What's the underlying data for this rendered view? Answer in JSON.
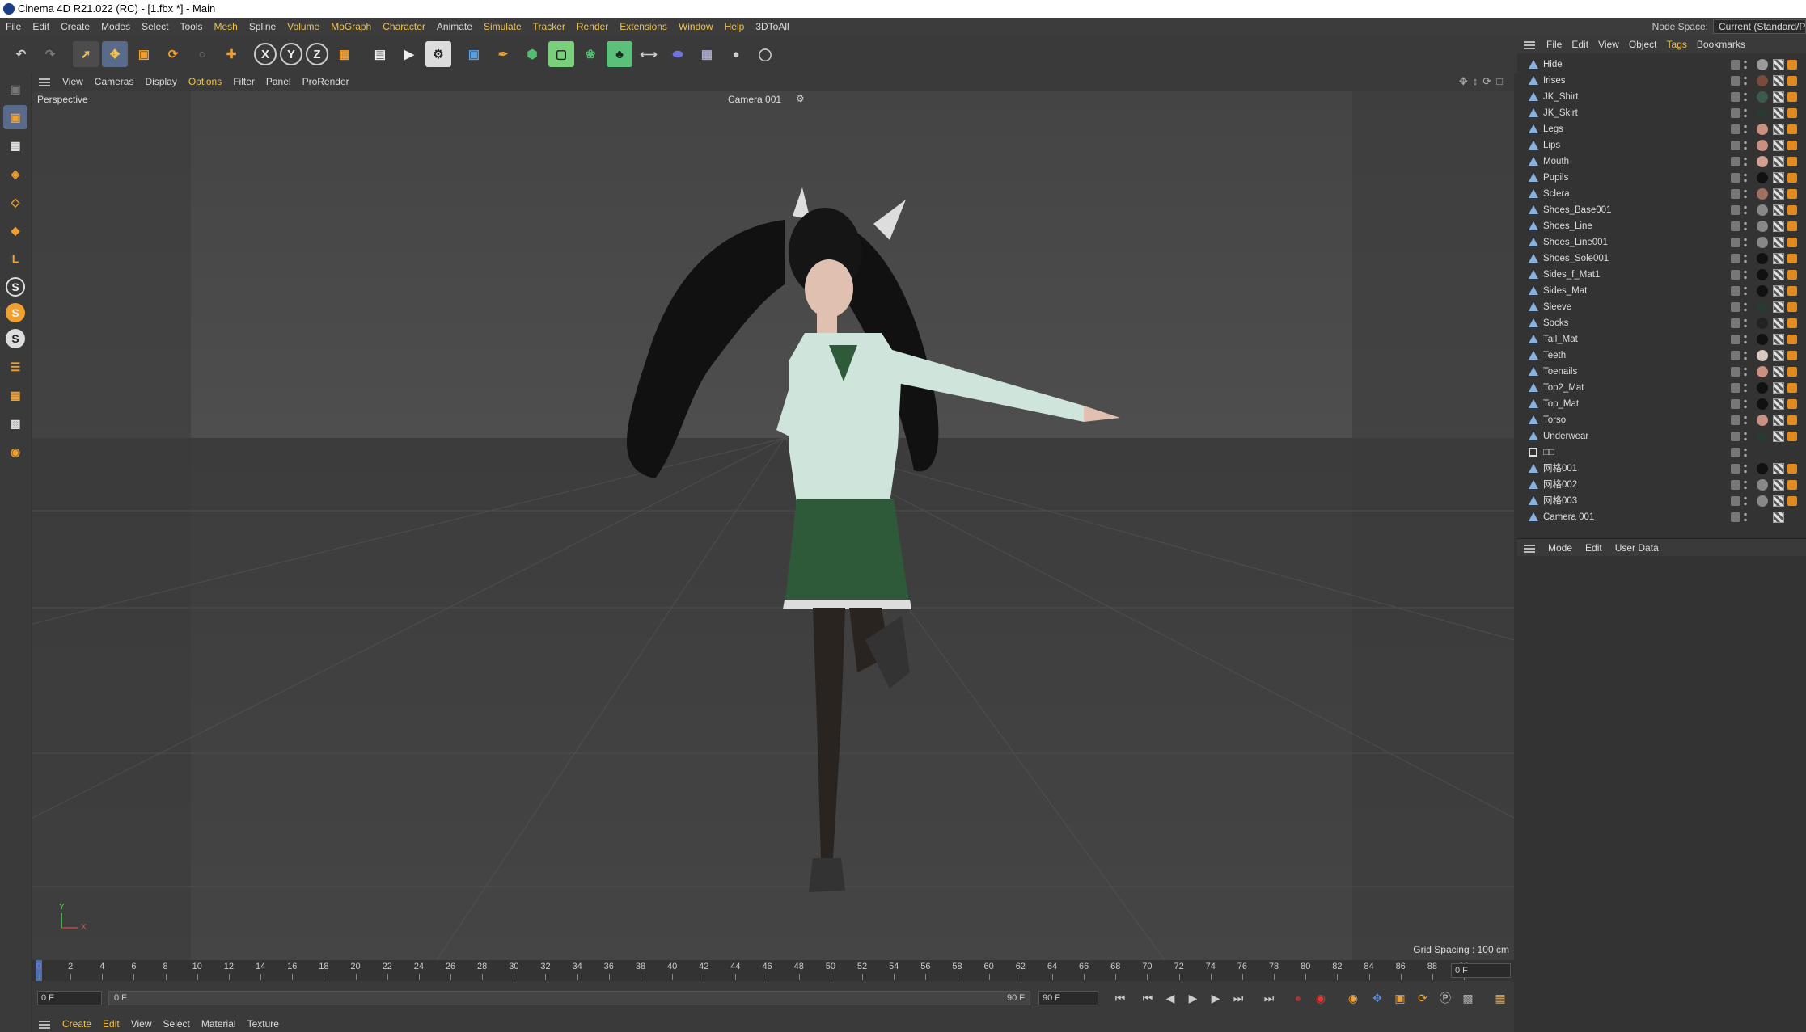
{
  "window": {
    "title": "Cinema 4D R21.022 (RC) - [1.fbx *] - Main"
  },
  "menubar": {
    "items": [
      "File",
      "Edit",
      "Create",
      "Modes",
      "Select",
      "Tools",
      "Mesh",
      "Spline",
      "Volume",
      "MoGraph",
      "Character",
      "Animate",
      "Simulate",
      "Tracker",
      "Render",
      "Extensions",
      "Window",
      "Help",
      "3DToAll"
    ],
    "node_space_label": "Node Space:",
    "node_space_value": "Current (Standard/P"
  },
  "toolbar": {
    "x_label": "X",
    "y_label": "Y",
    "z_label": "Z"
  },
  "leftbar": {
    "s_label": "S"
  },
  "viewport_menu": {
    "items": [
      "View",
      "Cameras",
      "Display",
      "Options",
      "Filter",
      "Panel",
      "ProRender"
    ]
  },
  "viewport": {
    "name": "Perspective",
    "camera": "Camera 001",
    "grid_spacing": "Grid Spacing : 100 cm",
    "axis_y": "Y",
    "axis_x": "X"
  },
  "timeline": {
    "ticks": [
      "0",
      "2",
      "4",
      "6",
      "8",
      "10",
      "12",
      "14",
      "16",
      "18",
      "20",
      "22",
      "24",
      "26",
      "28",
      "30",
      "32",
      "34",
      "36",
      "38",
      "40",
      "42",
      "44",
      "46",
      "48",
      "50",
      "52",
      "54",
      "56",
      "58",
      "60",
      "62",
      "64",
      "66",
      "68",
      "70",
      "72",
      "74",
      "76",
      "78",
      "80",
      "82",
      "84",
      "86",
      "88",
      "90"
    ],
    "current_frame": "0 F"
  },
  "transport": {
    "start": "0 F",
    "range_start": "0 F",
    "range_end": "90 F",
    "end": "90 F"
  },
  "material_menu": {
    "items": [
      "Create",
      "Edit",
      "View",
      "Select",
      "Material",
      "Texture"
    ]
  },
  "object_manager": {
    "menu": [
      "File",
      "Edit",
      "View",
      "Object",
      "Tags",
      "Bookmarks"
    ],
    "rows": [
      {
        "name": "Hide",
        "tag_color": "#9a9a9a"
      },
      {
        "name": "Irises",
        "tag_color": "#7a4a3a"
      },
      {
        "name": "JK_Shirt",
        "tag_color": "#3a5a4a"
      },
      {
        "name": "JK_Skirt",
        "tag_color": "#2a3a30"
      },
      {
        "name": "Legs",
        "tag_color": "#c89080"
      },
      {
        "name": "Lips",
        "tag_color": "#c89080"
      },
      {
        "name": "Mouth",
        "tag_color": "#d0a090"
      },
      {
        "name": "Pupils",
        "tag_color": "#111111"
      },
      {
        "name": "Sclera",
        "tag_color": "#a07060"
      },
      {
        "name": "Shoes_Base001",
        "tag_color": "#888888"
      },
      {
        "name": "Shoes_Line",
        "tag_color": "#888888"
      },
      {
        "name": "Shoes_Line001",
        "tag_color": "#888888"
      },
      {
        "name": "Shoes_Sole001",
        "tag_color": "#111111"
      },
      {
        "name": "Sides_f_Mat1",
        "tag_color": "#111111"
      },
      {
        "name": "Sides_Mat",
        "tag_color": "#111111"
      },
      {
        "name": "Sleeve",
        "tag_color": "#2a3a30"
      },
      {
        "name": "Socks",
        "tag_color": "#222222"
      },
      {
        "name": "Tail_Mat",
        "tag_color": "#111111"
      },
      {
        "name": "Teeth",
        "tag_color": "#d8c8c0"
      },
      {
        "name": "Toenails",
        "tag_color": "#c89080"
      },
      {
        "name": "Top2_Mat",
        "tag_color": "#111111"
      },
      {
        "name": "Top_Mat",
        "tag_color": "#111111"
      },
      {
        "name": "Torso",
        "tag_color": "#c89080"
      },
      {
        "name": "Underwear",
        "tag_color": "#2a3a30"
      },
      {
        "name": "□□",
        "tag_color": ""
      },
      {
        "name": "网格001",
        "tag_color": "#111111"
      },
      {
        "name": "网格002",
        "tag_color": "#888888"
      },
      {
        "name": "网格003",
        "tag_color": "#888888"
      },
      {
        "name": "Camera 001",
        "tag_color": ""
      }
    ]
  },
  "attributes": {
    "menu": [
      "Mode",
      "Edit",
      "User Data"
    ]
  },
  "colors": {
    "accent": "#f0c050",
    "viewport_bg": "#4a4a4a",
    "panel_bg": "#3a3a3a"
  }
}
